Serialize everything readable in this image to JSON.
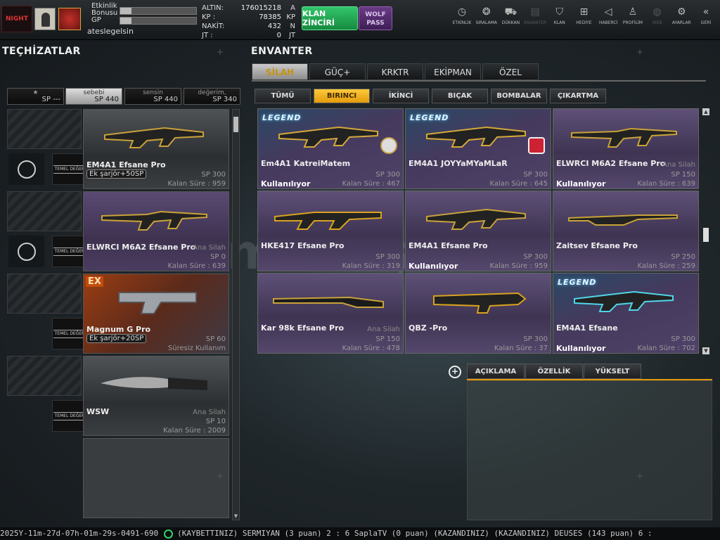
{
  "header": {
    "logo_text": "NIGHT",
    "stats": [
      {
        "label": "Etkinlik Bonusu",
        "fill": 0.15
      },
      {
        "label": "GP",
        "fill": 0.15
      }
    ],
    "username": "ateslegelsin",
    "currencies": [
      {
        "label": "ALTIN:",
        "value": "176015218",
        "unit": "A"
      },
      {
        "label": "KP   :",
        "value": "78385",
        "unit": "KP"
      },
      {
        "label": "NAKİT:",
        "value": "432",
        "unit": "N"
      },
      {
        "label": "JT   :",
        "value": "0",
        "unit": "JT"
      }
    ],
    "klan_button": "KLAN ZİNCİRİ",
    "wolf_button": "WOLF PASS",
    "nav": [
      {
        "label": "ETKİNLİK",
        "icon": "clock-icon",
        "glyph": "◷",
        "dim": false
      },
      {
        "label": "SIRALAMA",
        "icon": "medal-icon",
        "glyph": "❂",
        "dim": false
      },
      {
        "label": "DÜKKAN",
        "icon": "cart-icon",
        "glyph": "⛟",
        "dim": false
      },
      {
        "label": "ENVANTER",
        "icon": "inventory-icon",
        "glyph": "▤",
        "dim": true
      },
      {
        "label": "KLAN",
        "icon": "shield-icon",
        "glyph": "⛉",
        "dim": false
      },
      {
        "label": "HEDİYE",
        "icon": "gift-icon",
        "glyph": "⊞",
        "dim": false
      },
      {
        "label": "HABERCİ",
        "icon": "megaphone-icon",
        "glyph": "◁",
        "dim": false
      },
      {
        "label": "PROFİLİM",
        "icon": "profile-icon",
        "glyph": "♙",
        "dim": false
      },
      {
        "label": "WEB",
        "icon": "globe-icon",
        "glyph": "◍",
        "dim": true
      },
      {
        "label": "AYARLAR",
        "icon": "gear-icon",
        "glyph": "⚙",
        "dim": false
      },
      {
        "label": "GERİ",
        "icon": "back-icon",
        "glyph": "«",
        "dim": false
      }
    ]
  },
  "equipment": {
    "title": "TEÇHİZATLAR",
    "loadout_tabs": [
      {
        "name": "★",
        "sp": "SP ---"
      },
      {
        "name": "sebebi",
        "sp": "SP 440"
      },
      {
        "name": "sensin",
        "sp": "SP 440"
      },
      {
        "name": "değerim,",
        "sp": "SP 340"
      }
    ],
    "temel_deger": "TEMEL DEĞER",
    "slots": [
      {
        "title": "EM4A1 Efsane Pro",
        "sub": "Ek şarjör+50SP",
        "cat": "",
        "sp": "SP 300",
        "rem": "Kalan Süre : 959"
      },
      {
        "title": "ELWRCI M6A2 Efsane Pro",
        "sub": "",
        "cat": "Ana Silah",
        "sp": "SP 0",
        "rem": "Kalan Süre : 639"
      },
      {
        "title": "Magnum G Pro",
        "sub": "Ek şarjör+20SP",
        "cat": "",
        "sp": "SP 60",
        "rem": "Süresiz Kullanım",
        "badge": "EX"
      },
      {
        "title": "WSW",
        "sub": "",
        "cat": "Ana Silah",
        "sp": "SP 10",
        "rem": "Kalan Süre : 2009"
      }
    ]
  },
  "inventory": {
    "title": "ENVANTER",
    "tabs": [
      "SİLAH",
      "GÜÇ+",
      "KRKTR",
      "EKİPMAN",
      "ÖZEL"
    ],
    "subtabs": [
      "TÜMÜ",
      "BIRINCI",
      "İKİNCİ",
      "BIÇAK",
      "BOMBALAR",
      "ÇIKARTMA"
    ],
    "legend_text": "LEGEND",
    "items": [
      {
        "name": "Em4A1 KatreiMatem",
        "cat": "",
        "sp": "SP 300",
        "rem": "Kalan Süre : 467",
        "status": "Kullanılıyor"
      },
      {
        "name": "EM4A1 JOYYaMYaMLaR",
        "cat": "",
        "sp": "SP 300",
        "rem": "Kalan Süre : 645",
        "status": ""
      },
      {
        "name": "ELWRCI M6A2 Efsane Pro",
        "cat": "Ana Silah",
        "sp": "SP 150",
        "rem": "Kalan Süre : 639",
        "status": "Kullanılıyor"
      },
      {
        "name": "HKE417 Efsane Pro",
        "cat": "",
        "sp": "SP 300",
        "rem": "Kalan Süre : 319",
        "status": ""
      },
      {
        "name": "EM4A1 Efsane Pro",
        "cat": "",
        "sp": "SP 300",
        "rem": "Kalan Süre : 959",
        "status": "Kullanılıyor"
      },
      {
        "name": "Zaitsev Efsane Pro",
        "cat": "",
        "sp": "SP 250",
        "rem": "Kalan Süre : 259",
        "status": ""
      },
      {
        "name": "Kar 98k Efsane Pro",
        "cat": "Ana Silah",
        "sp": "SP 150",
        "rem": "Kalan Süre : 478",
        "status": ""
      },
      {
        "name": "QBZ -Pro",
        "cat": "",
        "sp": "SP 300",
        "rem": "Kalan Süre : 37",
        "status": ""
      },
      {
        "name": "EM4A1 Efsane",
        "cat": "",
        "sp": "SP 300",
        "rem": "Kalan Süre : 702",
        "status": "Kullanılıyor"
      }
    ],
    "detail_tabs": [
      "AÇIKLAMA",
      "ÖZELLİK",
      "YÜKSELT"
    ]
  },
  "watermark": "itemsatış",
  "ticker": {
    "prefix": "2025Y-11m-27d-07h-01m-29s-0491-690",
    "message": "(KAYBETTINIZ) SERMIYAN (3 puan) 2 : 6 SaplaTV (0 puan) (KAZANDINIZ)        (KAZANDINIZ) DEUSES (143 puan) 6 :"
  },
  "colors": {
    "accent": "#e29b0b",
    "klan_green": "#2bb35e",
    "wolf_purple": "#5a2f75",
    "card_purple": "#4a3c5f"
  }
}
